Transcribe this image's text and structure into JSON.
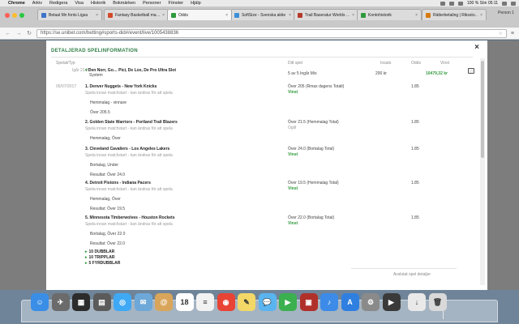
{
  "menubar": {
    "app": "Chrome",
    "items": [
      "Arkiv",
      "Redigera",
      "Visa",
      "Historik",
      "Bokmärken",
      "Personer",
      "Fönster",
      "Hjälp"
    ],
    "status": "100 %  Sön 05:11"
  },
  "tabs": [
    {
      "title": "Betaal Mn fonts Ligsa",
      "color": "#3d73c9"
    },
    {
      "title": "Fantasy Basketball ma…",
      "color": "#d24a2a"
    },
    {
      "title": "Odds",
      "color": "#2f9a3c"
    },
    {
      "title": "SoftSize - Svenska aktie…",
      "color": "#3e8fd8"
    },
    {
      "title": "Trail Baseratur Worlds …",
      "color": "#b53a2a"
    },
    {
      "title": "Kontohistorik",
      "color": "#2f9a3c"
    },
    {
      "title": "Rätterbetaling | Rikssto…",
      "color": "#d77a12"
    }
  ],
  "browser": {
    "url": "https://se.unibet.com/betting#sports-did#/event/live/1005438836",
    "profile": "Person 1"
  },
  "modal": {
    "title": "DETALJERAD SPELINFORMATION",
    "headers": {
      "date": "Spelat/Typ",
      "bet": "Ditt spel",
      "stake": "Insats",
      "odds": "Odds",
      "return": "Vinst"
    },
    "summary": {
      "time": "Igår 21:27",
      "selections": "Den Norr, Go… Pici, De Lox, De Pro Ultra Slot",
      "type": "System",
      "system_label": "5 av 5 Ingår Mix",
      "stake": "200 kr",
      "return": "10479,32 kr"
    },
    "date_line": "05/07/2017",
    "events": [
      {
        "title": "1. Denver Nuggets - New York Knicks",
        "desc": "Spela innan matchstart - kan ändras för att spela",
        "market": "Hemmalag - vinnare",
        "line": "Över 205.5",
        "bet": "Över 205 (Rmax dagens Totalt)",
        "result": "Vinst",
        "odds": "1.85"
      },
      {
        "title": "2. Golden State Warriors - Portland Trail Blazers",
        "desc": "Spela innan matchstart - kan ändras för att spela",
        "market": "Hemmalag, Över",
        "line": "",
        "bet": "Över 21.5 (Hemmalag Total)",
        "result": "Ogilt",
        "odds": "1.85"
      },
      {
        "title": "3. Cleveland Cavaliers - Los Angeles Lakers",
        "desc": "Spela innan matchstart - kan ändras för att spela",
        "market": "Bortalag, Under",
        "line": "Resultat: Över 24.0",
        "bet": "Över 24.0 (Bortalag Total)",
        "result": "Vinst",
        "odds": "1.85"
      },
      {
        "title": "4. Detroit Pistons - Indiana Pacers",
        "desc": "Spela innan matchstart - kan ändras för att spela",
        "market": "Hemmalag, Över",
        "line": "Resultat: Över 19.5",
        "bet": "Över 19.5 (Hemmalag Total)",
        "result": "Vinst",
        "odds": "1.85"
      },
      {
        "title": "5. Minnesota Timberwolves - Houston Rockets",
        "desc": "Spela innan matchstart - kan ändras för att spela",
        "market": "Bortalag, Över 22.0",
        "line": "Resultat: Över 22.0",
        "bet": "Över 22.0 (Bortalag Total)",
        "result": "Vinst",
        "odds": "1.85"
      }
    ],
    "expanders": [
      "10 DUBBLAR",
      "10 TRIPPLAR",
      "5 FYRDUBBLAR"
    ],
    "footer": "Avslutat spel detaljer"
  },
  "dock": [
    {
      "name": "finder-icon",
      "color": "#3a8ee6",
      "glyph": "☺"
    },
    {
      "name": "launchpad-icon",
      "color": "#6b6b6b",
      "glyph": "✈"
    },
    {
      "name": "mission-control-icon",
      "color": "#2c2c2c",
      "glyph": "▦"
    },
    {
      "name": "app-store-icon",
      "color": "#5b5b5b",
      "glyph": "▤"
    },
    {
      "name": "safari-icon",
      "color": "#3fa9f5",
      "glyph": "◎"
    },
    {
      "name": "mail-icon",
      "color": "#6da8d8",
      "glyph": "✉"
    },
    {
      "name": "contacts-icon",
      "color": "#d9a55a",
      "glyph": "@"
    },
    {
      "name": "calendar-icon",
      "color": "#ffffff",
      "glyph": "18"
    },
    {
      "name": "reminders-icon",
      "color": "#f2f2f2",
      "glyph": "≡"
    },
    {
      "name": "chrome-icon",
      "color": "#e84335",
      "glyph": "◉"
    },
    {
      "name": "notes-icon",
      "color": "#f3d868",
      "glyph": "✎"
    },
    {
      "name": "messages-icon",
      "color": "#5ab4f0",
      "glyph": "💬"
    },
    {
      "name": "facetime-icon",
      "color": "#3bb04f",
      "glyph": "▶"
    },
    {
      "name": "photo-booth-icon",
      "color": "#b0302a",
      "glyph": "▣"
    },
    {
      "name": "itunes-icon",
      "color": "#3c8be8",
      "glyph": "♪"
    },
    {
      "name": "app-store-blue-icon",
      "color": "#2f7fe0",
      "glyph": "A"
    },
    {
      "name": "system-preferences-icon",
      "color": "#8a8a8a",
      "glyph": "⚙"
    },
    {
      "name": "bettingapp-icon",
      "color": "#3a3a3a",
      "glyph": "▶"
    },
    {
      "name": "downloads-icon",
      "color": "#e9e9e9",
      "glyph": "↓"
    },
    {
      "name": "trash-icon",
      "color": "#d9d9d9",
      "glyph": "🗑"
    }
  ]
}
